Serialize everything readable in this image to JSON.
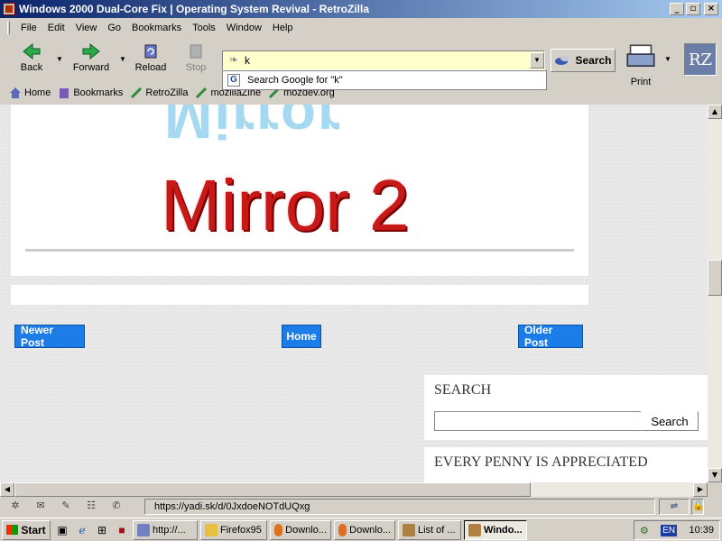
{
  "window": {
    "title": "Windows 2000 Dual-Core Fix | Operating System Revival - RetroZilla",
    "minimize": "_",
    "maximize": "▫",
    "close": "×"
  },
  "menu": [
    "File",
    "Edit",
    "View",
    "Go",
    "Bookmarks",
    "Tools",
    "Window",
    "Help"
  ],
  "nav": {
    "back": "Back",
    "forward": "Forward",
    "reload": "Reload",
    "stop": "Stop",
    "search": "Search",
    "print": "Print",
    "logo": "RZ"
  },
  "url": {
    "value": "k"
  },
  "autocomplete": {
    "item": "Search Google for \"k\""
  },
  "bookmarks": [
    "Home",
    "Bookmarks",
    "RetroZilla",
    "mozillaZine",
    "mozdev.org"
  ],
  "page": {
    "mirror_reflect": "Mirror",
    "mirror_main": "Mirror 2",
    "newer": "Newer Post",
    "home": "Home",
    "older": "Older Post",
    "search_heading": "SEARCH",
    "search_button": "Search",
    "penny_heading": "EVERY PENNY IS APPRECIATED"
  },
  "status": {
    "text": "https://yadi.sk/d/0JxdoeNOTdUQxg"
  },
  "taskbar": {
    "start": "Start",
    "tasks": [
      "http://...",
      "Firefox95",
      "Downlo...",
      "Downlo...",
      "List of ...",
      "Windo..."
    ],
    "lang": "EN",
    "clock": "10:39"
  }
}
